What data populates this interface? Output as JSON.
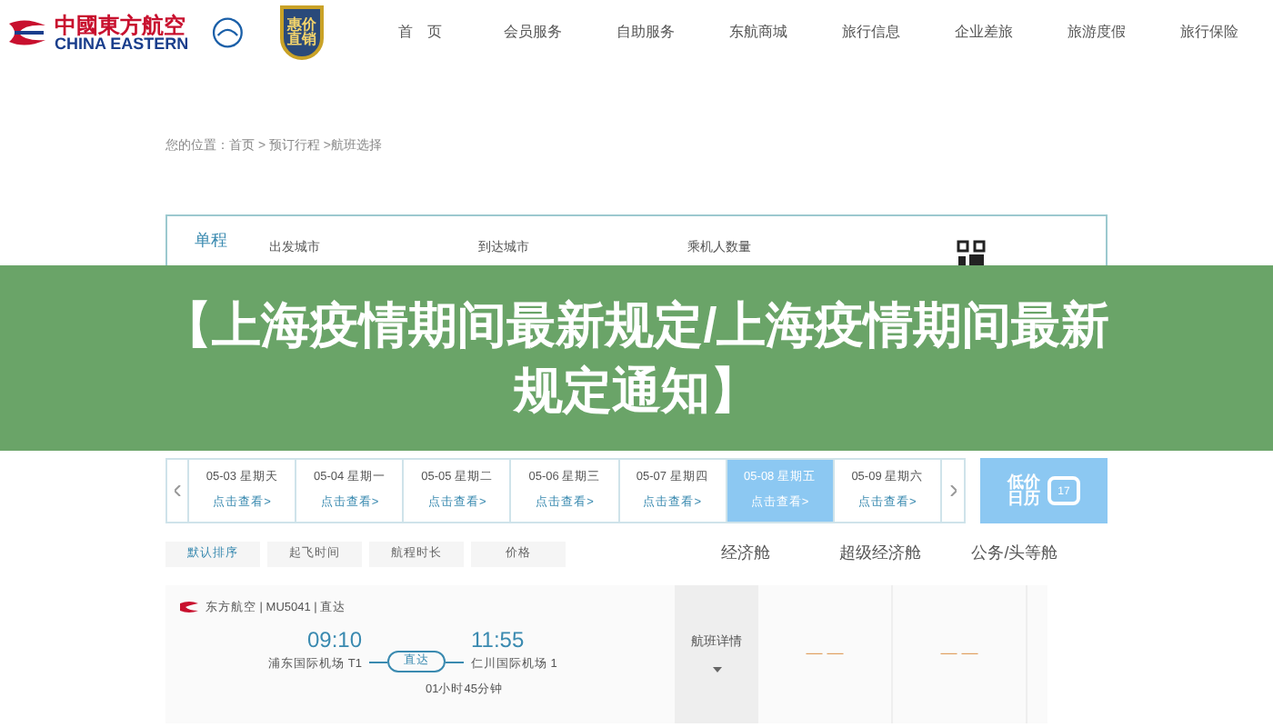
{
  "header": {
    "logo_cn": "中國東方航空",
    "logo_en": "CHINA EASTERN",
    "badge": [
      "惠价",
      "直销"
    ],
    "nav": [
      "首　页",
      "会员服务",
      "自助服务",
      "东航商城",
      "旅行信息",
      "企业差旅",
      "旅游度假",
      "旅行保险"
    ]
  },
  "breadcrumb": "您的位置：首页 > 预订行程 >航班选择",
  "search": {
    "trip_tab": "单程",
    "labels": [
      "出发城市",
      "到达城市",
      "乘机人数量"
    ]
  },
  "banner": {
    "title": "【上海疫情期间最新规定/上海疫情期间最新规定通知】"
  },
  "dates": [
    {
      "date": "05-03 星期天",
      "link": "点击查看>",
      "selected": false
    },
    {
      "date": "05-04 星期一",
      "link": "点击查看>",
      "selected": false
    },
    {
      "date": "05-05 星期二",
      "link": "点击查看>",
      "selected": false
    },
    {
      "date": "05-06 星期三",
      "link": "点击查看>",
      "selected": false
    },
    {
      "date": "05-07 星期四",
      "link": "点击查看>",
      "selected": false
    },
    {
      "date": "05-08 星期五",
      "link": "点击查看>",
      "selected": true
    },
    {
      "date": "05-09 星期六",
      "link": "点击查看>",
      "selected": false
    }
  ],
  "low_price_calendar": {
    "label": [
      "低价",
      "日历"
    ],
    "day": "17"
  },
  "sort_tabs": [
    {
      "label": "默认排序",
      "selected": true
    },
    {
      "label": "起飞时间",
      "selected": false
    },
    {
      "label": "航程时长",
      "selected": false
    },
    {
      "label": "价格",
      "selected": false
    }
  ],
  "cabins": [
    "经济舱",
    "超级经济舱",
    "公务/头等舱"
  ],
  "flight": {
    "airline": "东方航空 | MU5041 | 直达",
    "dep_time": "09:10",
    "dep_airport": "浦东国际机场 T1",
    "stop": "直达",
    "arr_time": "11:55",
    "arr_airport": "仁川国际机场 1",
    "duration": "01小时45分钟",
    "details": "航班详情",
    "prices": [
      "— —",
      "— —"
    ]
  }
}
